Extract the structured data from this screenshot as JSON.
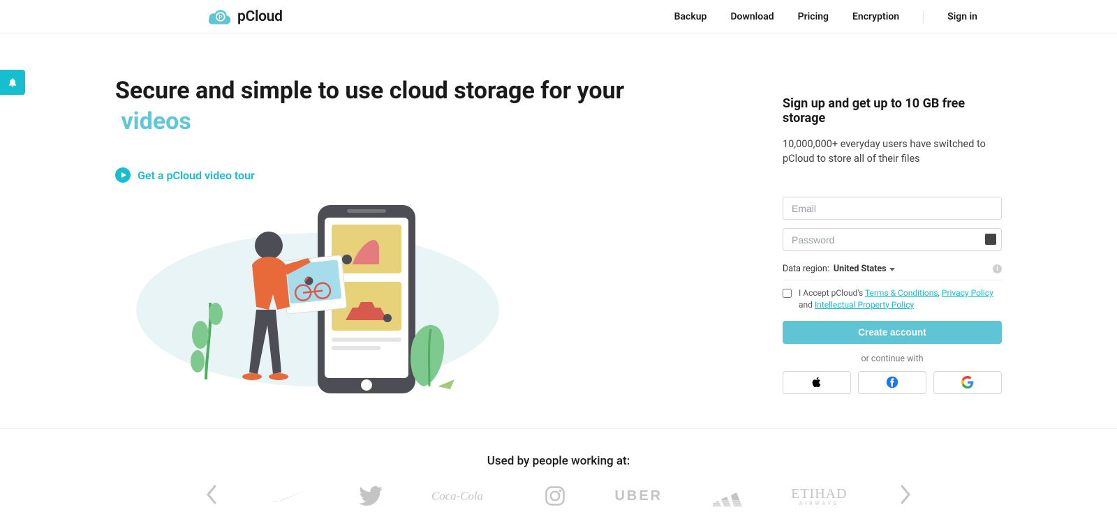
{
  "brand_name": "pCloud",
  "nav": {
    "backup": "Backup",
    "download": "Download",
    "pricing": "Pricing",
    "encryption": "Encryption",
    "signin": "Sign in"
  },
  "hero": {
    "headline_main": "Secure and simple to use cloud storage for your",
    "headline_accent": "videos",
    "tour": "Get a pCloud video tour"
  },
  "signup": {
    "title": "Sign up and get up to 10 GB free storage",
    "sub": "10,000,000+ everyday users have switched to pCloud to store all of their files",
    "email_ph": "Email",
    "password_ph": "Password",
    "region_label": "Data region:",
    "region_value": "United States",
    "accept_pre": "I Accept pCloud's ",
    "terms": "Terms & Conditions",
    "sep1": ", ",
    "privacy": "Privacy Policy",
    "and": " and ",
    "ip": "Intellectual Property Policy",
    "create": "Create account",
    "or": "or continue with"
  },
  "brands": {
    "title": "Used by people working at:",
    "uber": "UBER",
    "etihad": "ETIHAD",
    "etihad_sub": "AIRWAYS"
  }
}
